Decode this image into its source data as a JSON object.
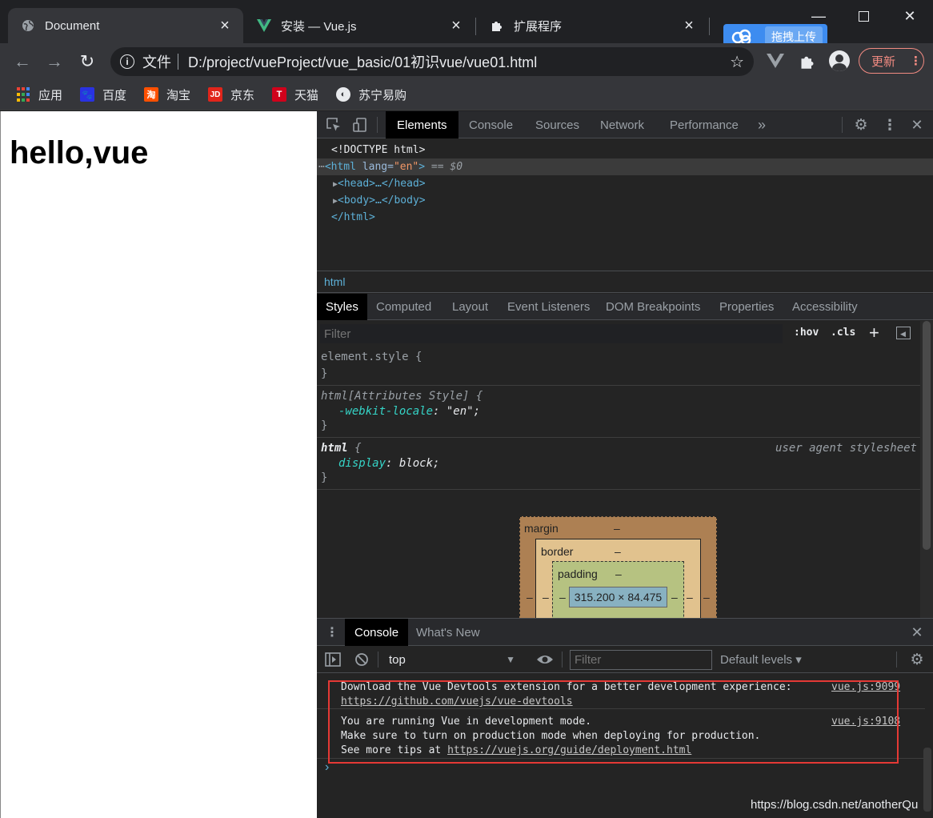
{
  "browser": {
    "tabs": [
      {
        "title": "Document",
        "icon": "globe-icon",
        "active": true
      },
      {
        "title": "安装 — Vue.js",
        "icon": "vue-logo-icon",
        "active": false
      },
      {
        "title": "扩展程序",
        "icon": "puzzle-icon",
        "active": false
      }
    ],
    "address": {
      "scheme_label": "文件",
      "url": "D:/project/vueProject/vue_basic/01初识vue/vue01.html"
    },
    "update_label": "更新",
    "upload_badge": "拖拽上传",
    "bookmarks": [
      {
        "label": "应用",
        "icon": "apps-grid-icon"
      },
      {
        "label": "百度",
        "icon": "baidu-paw-icon"
      },
      {
        "label": "淘宝",
        "icon": "taobao-icon"
      },
      {
        "label": "京东",
        "icon": "jd-icon"
      },
      {
        "label": "天猫",
        "icon": "tmall-icon"
      },
      {
        "label": "苏宁易购",
        "icon": "suning-icon"
      }
    ]
  },
  "page": {
    "heading": "hello,vue"
  },
  "devtools": {
    "main_tabs": [
      "Elements",
      "Console",
      "Sources",
      "Network",
      "Performance"
    ],
    "dom": {
      "doctype": "<!DOCTYPE html>",
      "html_open_tag": "<html",
      "html_attr_name": "lang",
      "html_attr_value": "\"en\"",
      "html_selected_suffix": "== $0",
      "head": "<head>…</head>",
      "body": "<body>…</body>",
      "html_close": "</html>"
    },
    "breadcrumb": "html",
    "style_tabs": [
      "Styles",
      "Computed",
      "Layout",
      "Event Listeners",
      "DOM Breakpoints",
      "Properties",
      "Accessibility"
    ],
    "filter_placeholder": "Filter",
    "hov_label": ":hov",
    "cls_label": ".cls",
    "rules": [
      {
        "selector": "element.style {",
        "lines": [],
        "close": "}"
      },
      {
        "selector": "html[Attributes Style] {",
        "lines": [
          {
            "prop": "-webkit-locale",
            "value": "\"en\";"
          }
        ],
        "close": "}"
      },
      {
        "selector": "html",
        "brace": "{",
        "origin": "user agent stylesheet",
        "lines": [
          {
            "prop": "display",
            "value": "block;"
          }
        ],
        "close": "}"
      }
    ],
    "box_model": {
      "margin_label": "margin",
      "border_label": "border",
      "padding_label": "padding",
      "dash": "–",
      "content_size": "315.200 × 84.475"
    },
    "drawer": {
      "tabs": [
        "Console",
        "What's New"
      ],
      "context": "top",
      "filter_placeholder": "Filter",
      "levels": "Default levels ▾",
      "messages": [
        {
          "lines": [
            "Download the Vue Devtools extension for a better development experience:"
          ],
          "link": "https://github.com/vuejs/vue-devtools",
          "source": "vue.js:9099"
        },
        {
          "lines": [
            "You are running Vue in development mode.",
            "Make sure to turn on production mode when deploying for production."
          ],
          "tip_prefix": "See more tips at ",
          "link": "https://vuejs.org/guide/deployment.html",
          "source": "vue.js:9108"
        }
      ],
      "prompt": "›"
    }
  },
  "watermark": "https://blog.csdn.net/anotherQu"
}
